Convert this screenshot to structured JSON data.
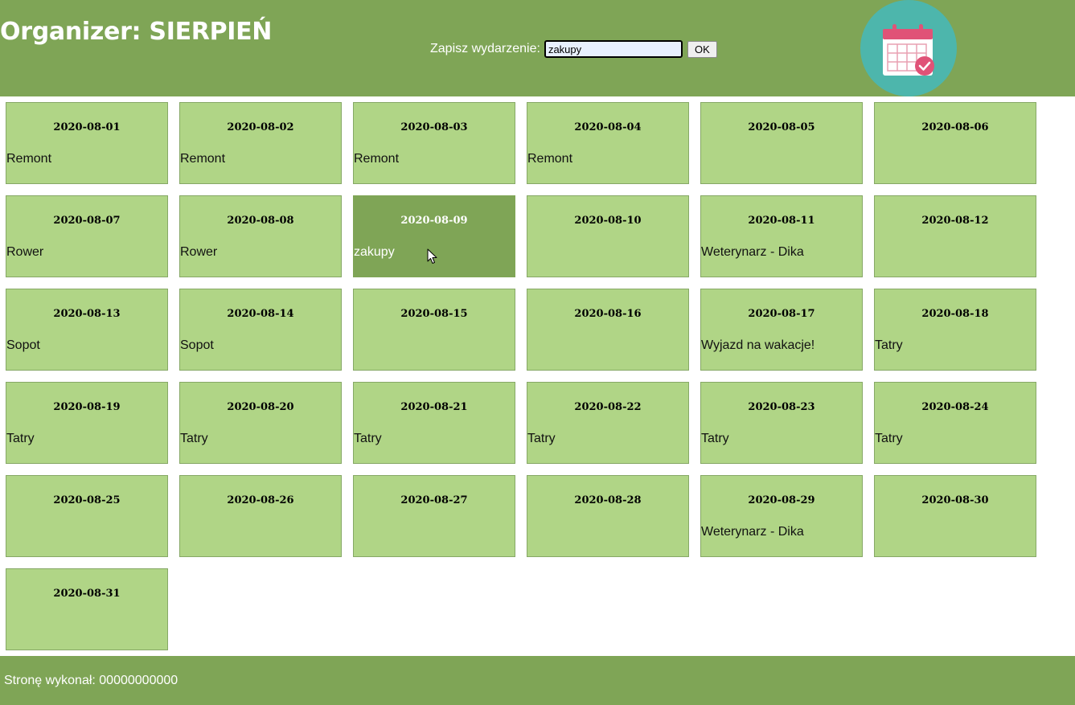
{
  "header": {
    "title": "Organizer: SIERPIEŃ",
    "form_label": "Zapisz wydarzenie:",
    "input_value": "zakupy",
    "ok_label": "OK"
  },
  "colors": {
    "header": "#7fa556",
    "tile": "#b0d586",
    "tile_active": "#7fa556",
    "logo_circle": "#4db6ac",
    "logo_accent": "#e05277"
  },
  "icons": {
    "logo": "calendar-check-icon",
    "cursor": "mouse-pointer-icon"
  },
  "active_date": "2020-08-09",
  "days": [
    {
      "date": "2020-08-01",
      "event": "Remont"
    },
    {
      "date": "2020-08-02",
      "event": "Remont"
    },
    {
      "date": "2020-08-03",
      "event": "Remont"
    },
    {
      "date": "2020-08-04",
      "event": "Remont"
    },
    {
      "date": "2020-08-05",
      "event": ""
    },
    {
      "date": "2020-08-06",
      "event": ""
    },
    {
      "date": "2020-08-07",
      "event": "Rower"
    },
    {
      "date": "2020-08-08",
      "event": "Rower"
    },
    {
      "date": "2020-08-09",
      "event": "zakupy"
    },
    {
      "date": "2020-08-10",
      "event": ""
    },
    {
      "date": "2020-08-11",
      "event": "Weterynarz - Dika"
    },
    {
      "date": "2020-08-12",
      "event": ""
    },
    {
      "date": "2020-08-13",
      "event": "Sopot"
    },
    {
      "date": "2020-08-14",
      "event": "Sopot"
    },
    {
      "date": "2020-08-15",
      "event": ""
    },
    {
      "date": "2020-08-16",
      "event": ""
    },
    {
      "date": "2020-08-17",
      "event": "Wyjazd na wakacje!"
    },
    {
      "date": "2020-08-18",
      "event": "Tatry"
    },
    {
      "date": "2020-08-19",
      "event": "Tatry"
    },
    {
      "date": "2020-08-20",
      "event": "Tatry"
    },
    {
      "date": "2020-08-21",
      "event": "Tatry"
    },
    {
      "date": "2020-08-22",
      "event": "Tatry"
    },
    {
      "date": "2020-08-23",
      "event": "Tatry"
    },
    {
      "date": "2020-08-24",
      "event": "Tatry"
    },
    {
      "date": "2020-08-25",
      "event": ""
    },
    {
      "date": "2020-08-26",
      "event": ""
    },
    {
      "date": "2020-08-27",
      "event": ""
    },
    {
      "date": "2020-08-28",
      "event": ""
    },
    {
      "date": "2020-08-29",
      "event": "Weterynarz - Dika"
    },
    {
      "date": "2020-08-30",
      "event": ""
    },
    {
      "date": "2020-08-31",
      "event": ""
    }
  ],
  "footer": {
    "text": "Stronę wykonał: 00000000000"
  }
}
